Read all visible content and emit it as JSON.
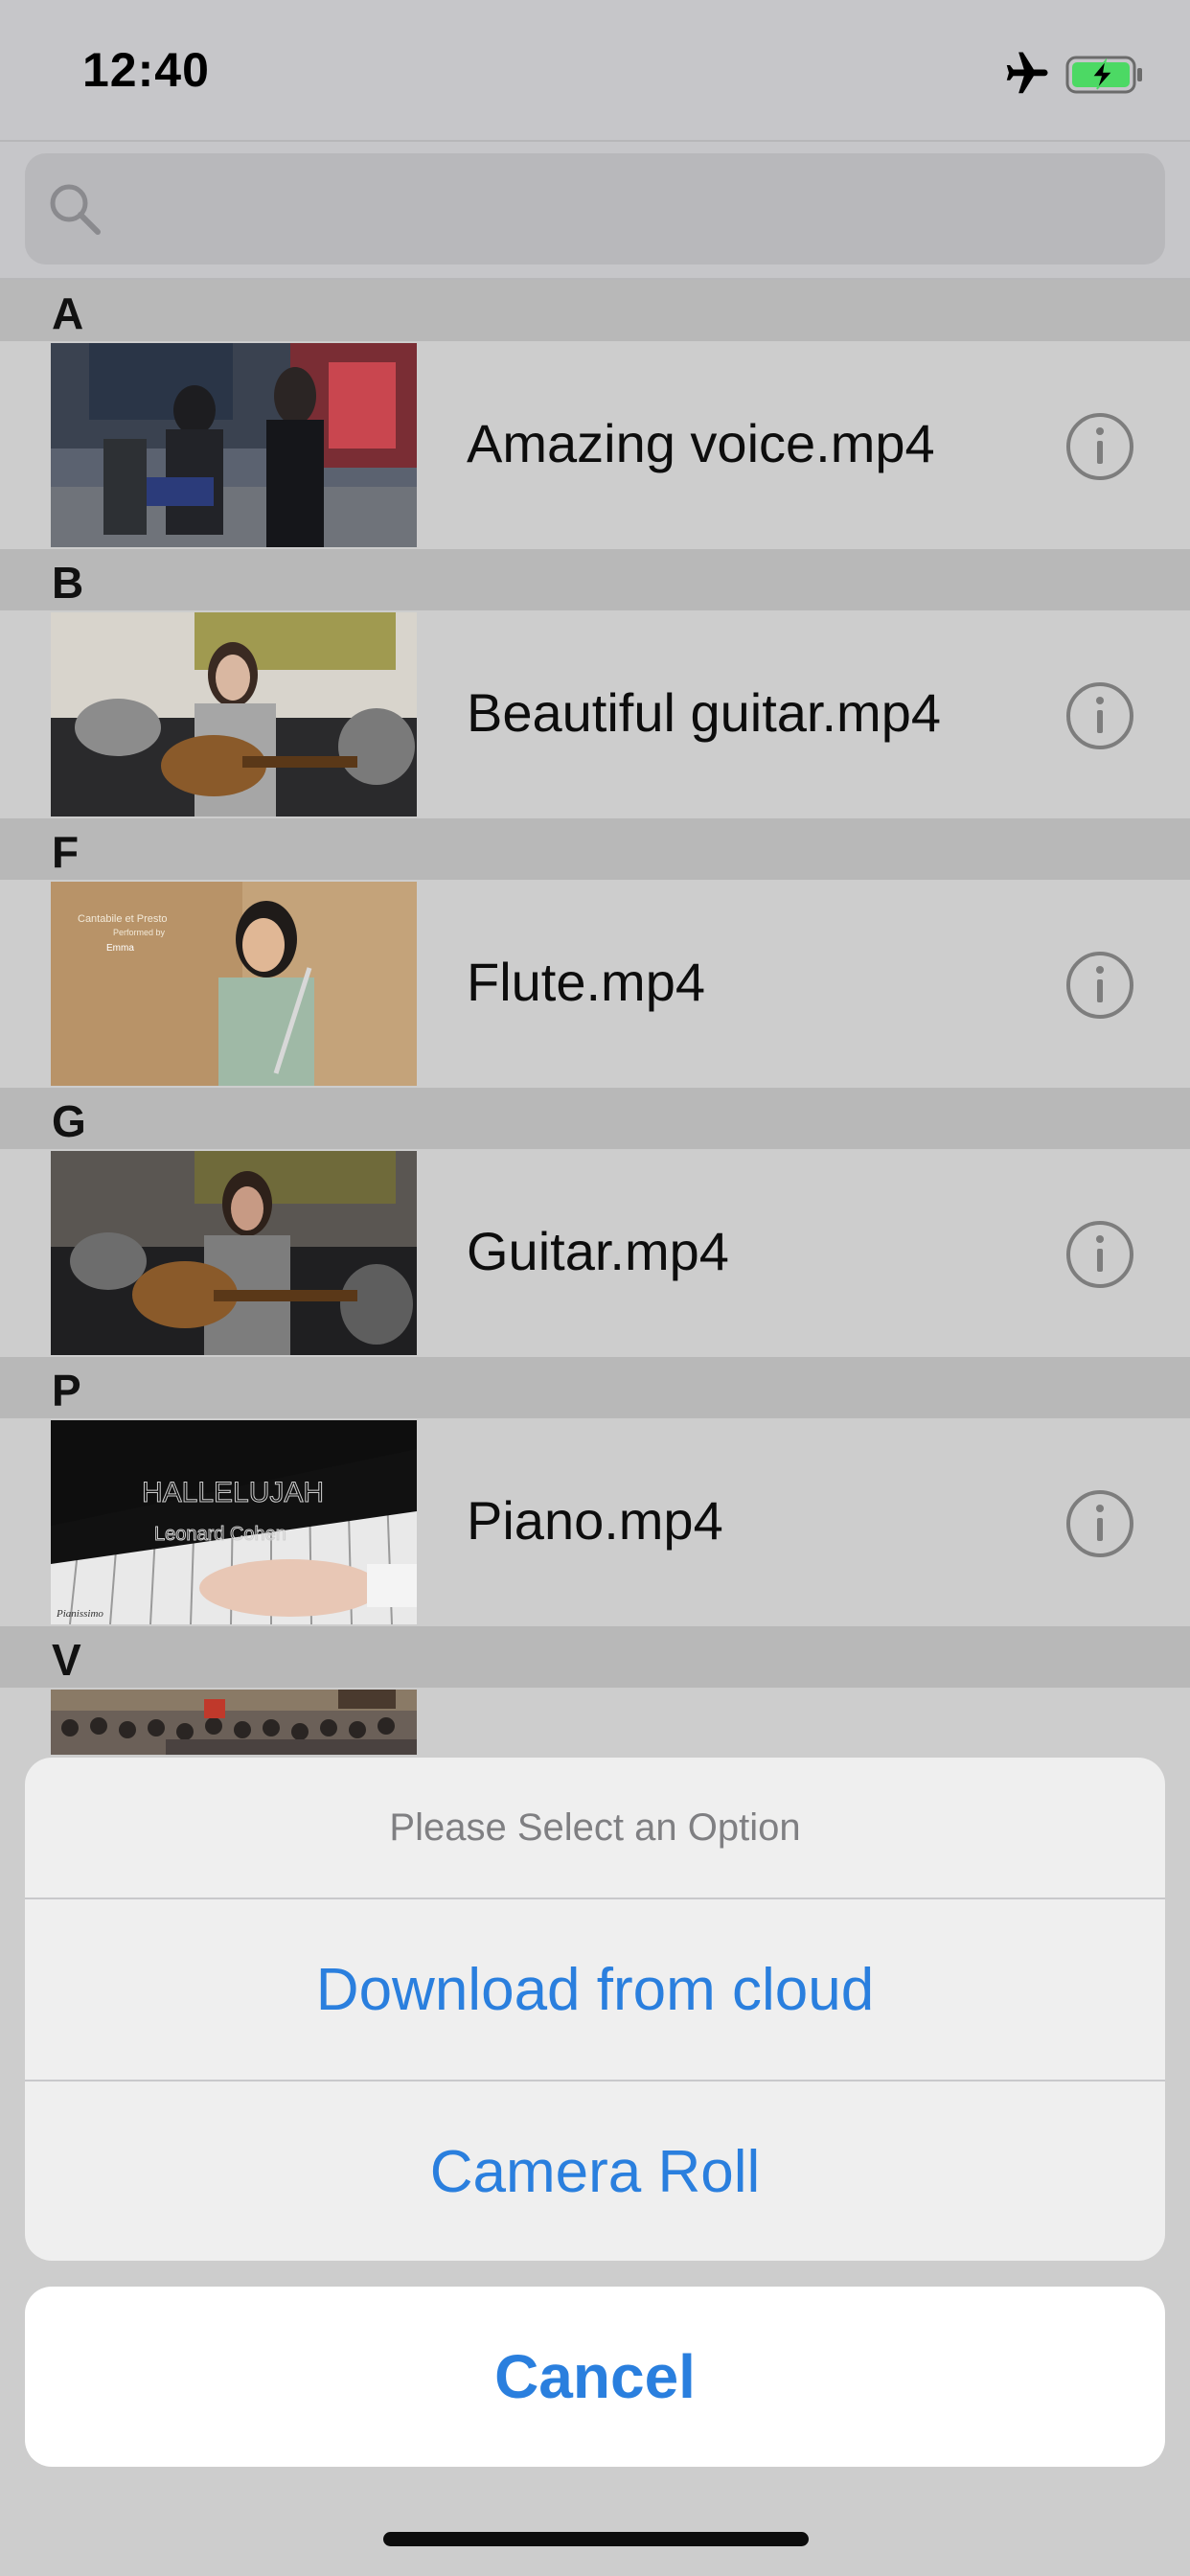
{
  "status_bar": {
    "time": "12:40",
    "airplane_icon": "airplane-icon",
    "battery_icon": "battery-charging-icon",
    "battery_color": "#4cd964"
  },
  "search": {
    "icon": "search-icon",
    "placeholder": ""
  },
  "sections": [
    {
      "letter": "A",
      "items": [
        {
          "title": "Amazing voice.mp4",
          "thumbnail": "street-performers-thumbnail"
        }
      ]
    },
    {
      "letter": "B",
      "items": [
        {
          "title": "Beautiful guitar.mp4",
          "thumbnail": "girl-playing-guitar-thumbnail"
        }
      ]
    },
    {
      "letter": "F",
      "items": [
        {
          "title": "Flute.mp4",
          "thumbnail": "girl-with-flute-thumbnail",
          "overlay_lines": [
            "Cantabile et Presto",
            "Performed by",
            "Emma"
          ]
        }
      ]
    },
    {
      "letter": "G",
      "items": [
        {
          "title": "Guitar.mp4",
          "thumbnail": "girl-playing-guitar-thumbnail"
        }
      ]
    },
    {
      "letter": "P",
      "items": [
        {
          "title": "Piano.mp4",
          "thumbnail": "piano-hands-thumbnail",
          "overlay_lines": [
            "HALLELUJAH",
            "Leonard Cohen",
            "Pianissimo"
          ]
        }
      ]
    },
    {
      "letter": "V",
      "items": [
        {
          "title": "",
          "thumbnail": "crowd-street-thumbnail"
        }
      ]
    }
  ],
  "action_sheet": {
    "title": "Please Select an Option",
    "actions": [
      "Download from cloud",
      "Camera Roll"
    ],
    "cancel": "Cancel",
    "accent_color": "#2a7fde"
  }
}
